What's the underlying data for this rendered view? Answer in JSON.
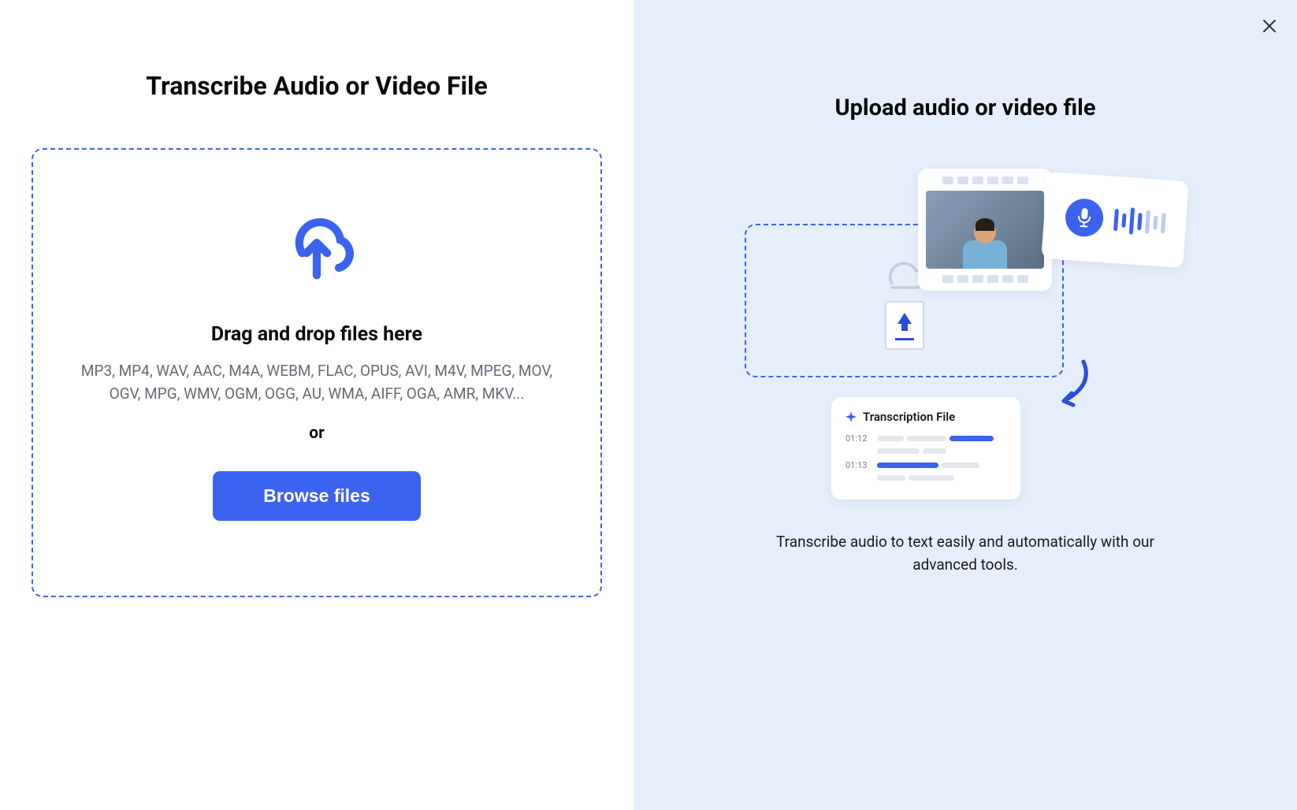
{
  "left": {
    "title": "Transcribe Audio or Video File",
    "drop_heading": "Drag and drop files here",
    "formats": "MP3, MP4, WAV, AAC, M4A, WEBM, FLAC, OPUS, AVI, M4V, MPEG, MOV, OGV, MPG, WMV, OGM, OGG, AU, WMA, AIFF, OGA, AMR, MKV...",
    "or": "or",
    "browse_button": "Browse files"
  },
  "right": {
    "title": "Upload audio or video file",
    "description": "Transcribe audio to text easily and automatically with our advanced tools.",
    "transcription_card": {
      "title": "Transcription File",
      "row1_time": "01:12",
      "row2_time": "01:13"
    }
  }
}
